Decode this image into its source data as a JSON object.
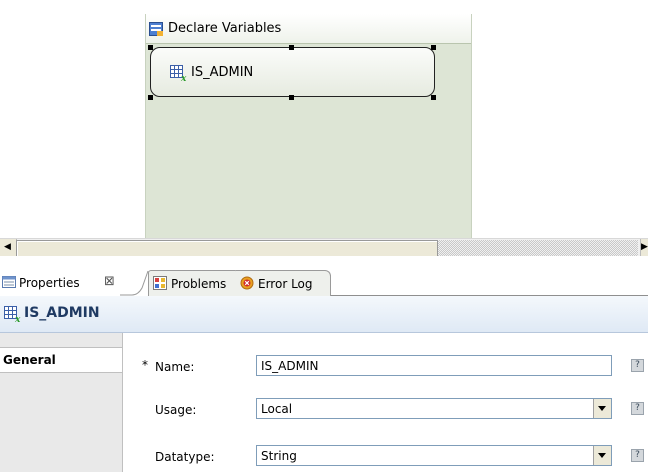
{
  "diagram": {
    "container": {
      "title": "Declare Variables",
      "icon": "declare-variables-icon"
    },
    "variable": {
      "label": "IS_ADMIN",
      "icon": "variable-table-icon"
    }
  },
  "tabs": [
    {
      "label": "Properties",
      "icon": "properties-icon",
      "close_glyph": "⊠",
      "active": true
    },
    {
      "label": "Problems",
      "icon": "problems-icon",
      "active": false
    },
    {
      "label": "Error Log",
      "icon": "error-log-icon",
      "active": false
    }
  ],
  "properties": {
    "header_title": "IS_ADMIN",
    "sections": [
      "General"
    ],
    "fields": {
      "name": {
        "required_marker": "*",
        "label": "Name:",
        "value": "IS_ADMIN"
      },
      "usage": {
        "label": "Usage:",
        "value": "Local"
      },
      "datatype": {
        "label": "Datatype:",
        "value": "String"
      }
    },
    "help_glyph": "?"
  },
  "colors": {
    "container_fill": "#dde5d5",
    "header_title": "#1f3a63"
  }
}
